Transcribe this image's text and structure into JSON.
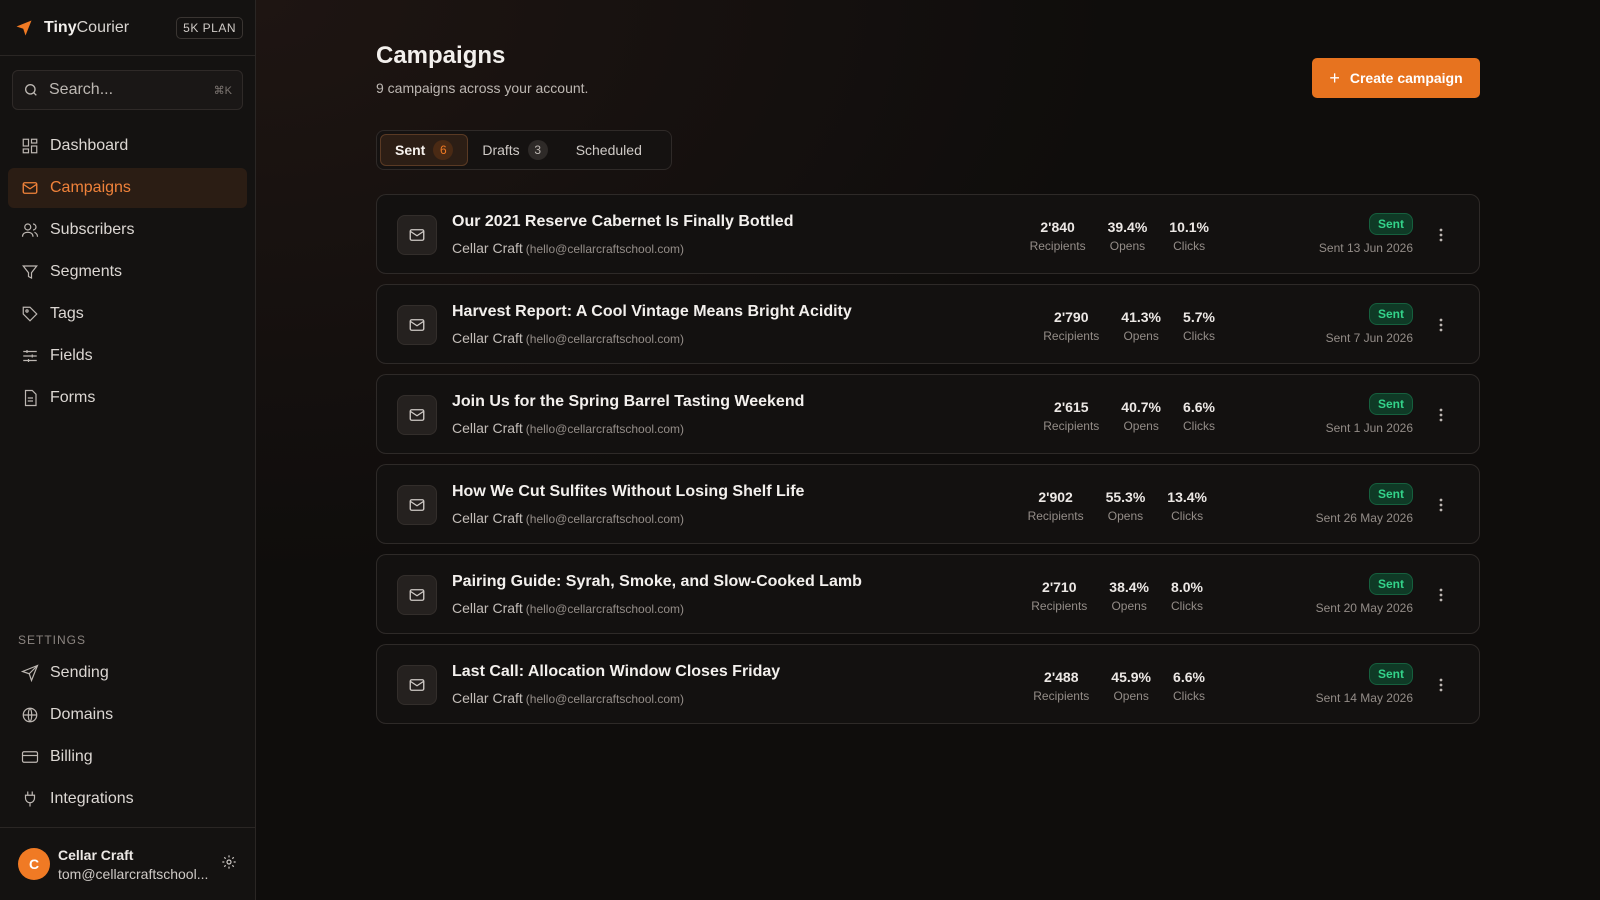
{
  "brand": {
    "name_bold": "Tiny",
    "name_rest": "Courier",
    "plan": "5K PLAN"
  },
  "search": {
    "placeholder": "Search...",
    "shortcut": "⌘K"
  },
  "nav": {
    "items": [
      {
        "label": "Dashboard",
        "icon": "dashboard-icon"
      },
      {
        "label": "Campaigns",
        "icon": "mail-icon",
        "active": true
      },
      {
        "label": "Subscribers",
        "icon": "users-icon"
      },
      {
        "label": "Segments",
        "icon": "filter-icon"
      },
      {
        "label": "Tags",
        "icon": "tag-icon"
      },
      {
        "label": "Fields",
        "icon": "sliders-icon"
      },
      {
        "label": "Forms",
        "icon": "file-icon"
      }
    ],
    "settings_heading": "SETTINGS",
    "settings": [
      {
        "label": "Sending",
        "icon": "send-icon"
      },
      {
        "label": "Domains",
        "icon": "globe-icon"
      },
      {
        "label": "Billing",
        "icon": "card-icon"
      },
      {
        "label": "Integrations",
        "icon": "plug-icon"
      }
    ]
  },
  "user": {
    "initial": "C",
    "name": "Cellar Craft",
    "email": "tom@cellarcraftschool..."
  },
  "header": {
    "title": "Campaigns",
    "subtitle": "9 campaigns across your account.",
    "create_label": "Create campaign"
  },
  "tabs": [
    {
      "label": "Sent",
      "count": "6",
      "active": true
    },
    {
      "label": "Drafts",
      "count": "3"
    },
    {
      "label": "Scheduled",
      "count": ""
    }
  ],
  "campaigns": [
    {
      "title": "Our 2021 Reserve Cabernet Is Finally Bottled",
      "sender": "Cellar Craft",
      "email": "(hello@cellarcraftschool.com)",
      "recipients": "2'840",
      "opens": "39.4%",
      "clicks": "10.1%",
      "status": "Sent",
      "date": "Sent 13 Jun 2026"
    },
    {
      "title": "Harvest Report: A Cool Vintage Means Bright Acidity",
      "sender": "Cellar Craft",
      "email": "(hello@cellarcraftschool.com)",
      "recipients": "2'790",
      "opens": "41.3%",
      "clicks": "5.7%",
      "status": "Sent",
      "date": "Sent 7 Jun 2026"
    },
    {
      "title": "Join Us for the Spring Barrel Tasting Weekend",
      "sender": "Cellar Craft",
      "email": "(hello@cellarcraftschool.com)",
      "recipients": "2'615",
      "opens": "40.7%",
      "clicks": "6.6%",
      "status": "Sent",
      "date": "Sent 1 Jun 2026"
    },
    {
      "title": "How We Cut Sulfites Without Losing Shelf Life",
      "sender": "Cellar Craft",
      "email": "(hello@cellarcraftschool.com)",
      "recipients": "2'902",
      "opens": "55.3%",
      "clicks": "13.4%",
      "status": "Sent",
      "date": "Sent 26 May 2026"
    },
    {
      "title": "Pairing Guide: Syrah, Smoke, and Slow-Cooked Lamb",
      "sender": "Cellar Craft",
      "email": "(hello@cellarcraftschool.com)",
      "recipients": "2'710",
      "opens": "38.4%",
      "clicks": "8.0%",
      "status": "Sent",
      "date": "Sent 20 May 2026"
    },
    {
      "title": "Last Call: Allocation Window Closes Friday",
      "sender": "Cellar Craft",
      "email": "(hello@cellarcraftschool.com)",
      "recipients": "2'488",
      "opens": "45.9%",
      "clicks": "6.6%",
      "status": "Sent",
      "date": "Sent 14 May 2026"
    }
  ],
  "stat_labels": {
    "recipients": "Recipients",
    "opens": "Opens",
    "clicks": "Clicks"
  },
  "colors": {
    "accent": "#e7731f",
    "sent_badge": "#33d38a",
    "background": "#0f0d0c"
  }
}
